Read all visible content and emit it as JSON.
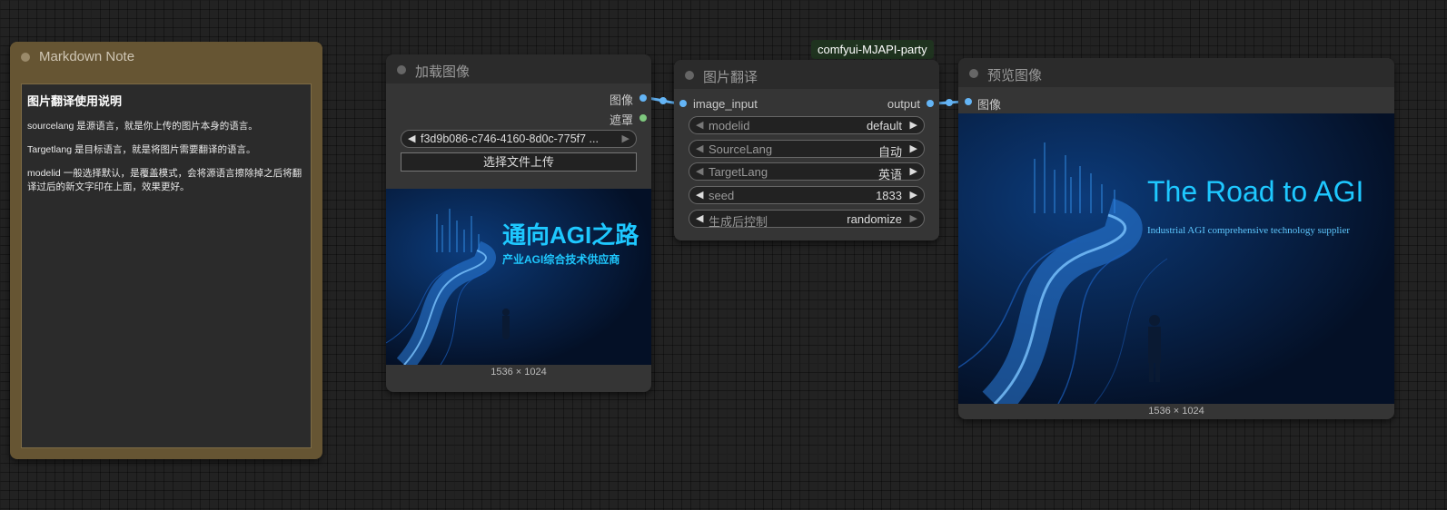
{
  "note": {
    "title": "Markdown Note",
    "heading": "图片翻译使用说明",
    "paragraphs": [
      "sourcelang 是源语言，就是你上传的图片本身的语言。",
      "Targetlang 是目标语言，就是将图片需要翻译的语言。",
      "modelid 一般选择默认，是覆盖模式，会将源语言擦除掉之后将翻译过后的新文字印在上面，效果更好。"
    ]
  },
  "load_image": {
    "title": "加载图像",
    "outputs": [
      "图像",
      "遮罩"
    ],
    "file_value": "f3d9b086-c746-4160-8d0c-775f7 ...",
    "upload_label": "选择文件上传",
    "caption": "1536 × 1024",
    "image_text": {
      "headline": "通向AGI之路",
      "subline": "产业AGI综合技术供应商"
    }
  },
  "translate": {
    "badge": "comfyui-MJAPI-party",
    "title": "图片翻译",
    "input": "image_input",
    "output": "output",
    "widgets": [
      {
        "label": "modelid",
        "value": "default"
      },
      {
        "label": "SourceLang",
        "value": "自动"
      },
      {
        "label": "TargetLang",
        "value": "英语"
      },
      {
        "label": "seed",
        "value": "1833"
      },
      {
        "label": "生成后控制",
        "value": "randomize"
      }
    ]
  },
  "preview": {
    "title": "预览图像",
    "input": "图像",
    "caption": "1536 × 1024",
    "image_text": {
      "headline": "The Road to AGI",
      "subline": "Industrial AGI comprehensive technology supplier"
    }
  },
  "colors": {
    "canvas": "#222222",
    "node": "#353535",
    "note": "#665533",
    "image_slot": "#64b5f6",
    "mask_slot": "#7ec87e",
    "badge_bg": "#1f331f",
    "image_text": "#1ec8ff"
  }
}
